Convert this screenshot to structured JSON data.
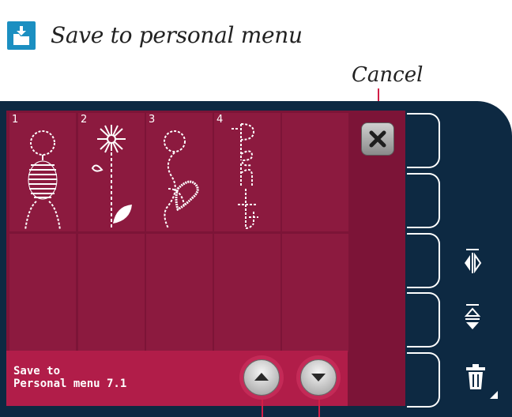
{
  "header": {
    "title": "Save to personal menu",
    "icon": "folder-save-icon"
  },
  "callouts": {
    "cancel": "Cancel"
  },
  "grid": {
    "cells": [
      {
        "number": "1",
        "stitch": "circle-ball-stitch"
      },
      {
        "number": "2",
        "stitch": "flower-stitch"
      },
      {
        "number": "3",
        "stitch": "circle-heart-stitch"
      },
      {
        "number": "4",
        "stitch": "pen-text-stitch"
      },
      {
        "number": "",
        "stitch": ""
      },
      {
        "number": "",
        "stitch": ""
      },
      {
        "number": "",
        "stitch": ""
      },
      {
        "number": "",
        "stitch": ""
      },
      {
        "number": "",
        "stitch": ""
      },
      {
        "number": "",
        "stitch": ""
      }
    ]
  },
  "status": {
    "line1": "Save to",
    "line2": "Personal menu 7.1"
  },
  "buttons": {
    "cancel_icon": "close-icon",
    "scroll_up_icon": "arrow-up-icon",
    "scroll_down_icon": "arrow-down-icon"
  },
  "side_panel": {
    "items": [
      "blank",
      "blank",
      "mirror-side-to-side-icon",
      "mirror-end-to-end-icon",
      "delete-icon"
    ]
  },
  "colors": {
    "screen": "#7c1437",
    "cell": "#8c1a3f",
    "bar": "#b11d49",
    "frame": "#0d2942",
    "accent": "#1b8fc1",
    "callout": "#d21f47"
  }
}
